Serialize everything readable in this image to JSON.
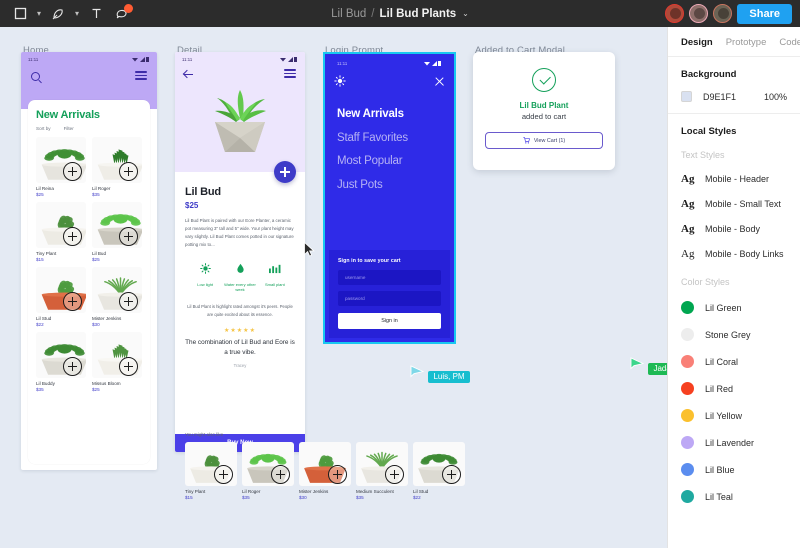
{
  "topbar": {
    "tools": [
      {
        "name": "frame-tool",
        "glyph": "▭"
      },
      {
        "name": "pen-tool",
        "glyph": "✎"
      },
      {
        "name": "text-tool",
        "glyph": "T"
      },
      {
        "name": "comment-tool",
        "glyph": "💬"
      }
    ],
    "project": "Lil Bud",
    "separator": "/",
    "page": "Lil Bud Plants",
    "page_caret": "⌄",
    "share_label": "Share",
    "avatar_count": 3
  },
  "frames": {
    "home": "Home",
    "detail": "Detail",
    "login": "Login Prompt",
    "cart": "Added to Cart Modal"
  },
  "home": {
    "status_time": "11:11",
    "search_icon": "search-icon",
    "menu_icon": "hamburger-icon",
    "heading": "New Arrivals",
    "filters": [
      "Sort by",
      "Filter"
    ],
    "products": [
      {
        "name": "Lil Reina",
        "price": "$25"
      },
      {
        "name": "Lil Roger",
        "price": "$35"
      },
      {
        "name": "Tiny Plant",
        "price": "$15"
      },
      {
        "name": "Lil Bud",
        "price": "$25"
      },
      {
        "name": "Lil Stud",
        "price": "$22"
      },
      {
        "name": "Mister Jenkins",
        "price": "$30"
      },
      {
        "name": "Lil Buddy",
        "price": "$35"
      },
      {
        "name": "Missus Bloom",
        "price": "$25"
      }
    ]
  },
  "detail": {
    "status_time": "11:11",
    "back_icon": "back-arrow-icon",
    "menu_icon": "hamburger-icon",
    "add_icon": "plus-icon",
    "title": "Lil Bud",
    "price": "$25",
    "description": "Lil Bud Plant is paired with our Eore Planter, a ceramic pot measuring 3\" tall and 5\" wide. Your plant height may vary slightly. Lil Bud Plant comes potted in our signature potting mix to...",
    "care": [
      {
        "icon": "sun-icon",
        "label": "Low light"
      },
      {
        "icon": "water-drop-icon",
        "label": "Water every other week"
      },
      {
        "icon": "bar-chart-icon",
        "label": "Small plant"
      }
    ],
    "review_text": "Lil Bud Plant is highlight rated amongst it's peers. People are quite excited about its essence.",
    "stars": "★★★★★",
    "quote": "The combination of Lil Bud and Eore is a true vibe.",
    "quote_by": "Tracey",
    "also_like_title": "You might also like",
    "also_like": [
      {
        "name": "Tiny Plant",
        "price": "$15"
      },
      {
        "name": "Lil Roger",
        "price": "$35"
      },
      {
        "name": "Mister Jenkins",
        "price": "$30"
      },
      {
        "name": "Medium Succulent",
        "price": "$35"
      },
      {
        "name": "Lil Stud",
        "price": "$22"
      }
    ],
    "buy_now": "Buy Now"
  },
  "login": {
    "status_time": "11:11",
    "logo_icon": "sun-icon",
    "close_icon": "close-icon",
    "menu": [
      "New Arrivals",
      "Staff Favorites",
      "Most Popular",
      "Just Pots"
    ],
    "card_title": "Sign in to save your cart",
    "username_placeholder": "username",
    "password_placeholder": "password",
    "signin_label": "Sign in"
  },
  "cart": {
    "check_icon": "check-circle-icon",
    "product": "Lil Bud Plant",
    "subtitle": "added to cart",
    "cart_icon": "cart-icon",
    "view_cart_label": "View Cart (1)"
  },
  "cursors": [
    {
      "name": "Luis, PM",
      "color": "#17BECF"
    },
    {
      "name": "Jada",
      "color": "#1DB954"
    }
  ],
  "panel": {
    "tabs": [
      {
        "label": "Design",
        "active": true
      },
      {
        "label": "Prototype",
        "active": false
      },
      {
        "label": "Code",
        "active": false
      }
    ],
    "background": {
      "heading": "Background",
      "swatch": "#D9E1F1",
      "hex": "D9E1F1",
      "opacity": "100%"
    },
    "local_styles_heading": "Local Styles",
    "text_styles_label": "Text Styles",
    "text_styles": [
      {
        "sample": "Ag",
        "name": "Mobile - Header",
        "weight": "bold"
      },
      {
        "sample": "Ag",
        "name": "Mobile - Small Text",
        "weight": "bold"
      },
      {
        "sample": "Ag",
        "name": "Mobile - Body",
        "weight": "bold"
      },
      {
        "sample": "Ag",
        "name": "Mobile - Body Links",
        "weight": "thin"
      }
    ],
    "color_styles_label": "Color Styles",
    "color_styles": [
      {
        "name": "Lil Green",
        "hex": "#00A650"
      },
      {
        "name": "Stone Grey",
        "hex": "#EDEDED"
      },
      {
        "name": "Lil Coral",
        "hex": "#F98077"
      },
      {
        "name": "Lil Red",
        "hex": "#F64020"
      },
      {
        "name": "Lil Yellow",
        "hex": "#FBC02D"
      },
      {
        "name": "Lil Lavender",
        "hex": "#BDA8F5"
      },
      {
        "name": "Lil Blue",
        "hex": "#5B8DEF"
      },
      {
        "name": "Lil Teal",
        "hex": "#1FA9A0"
      }
    ]
  }
}
